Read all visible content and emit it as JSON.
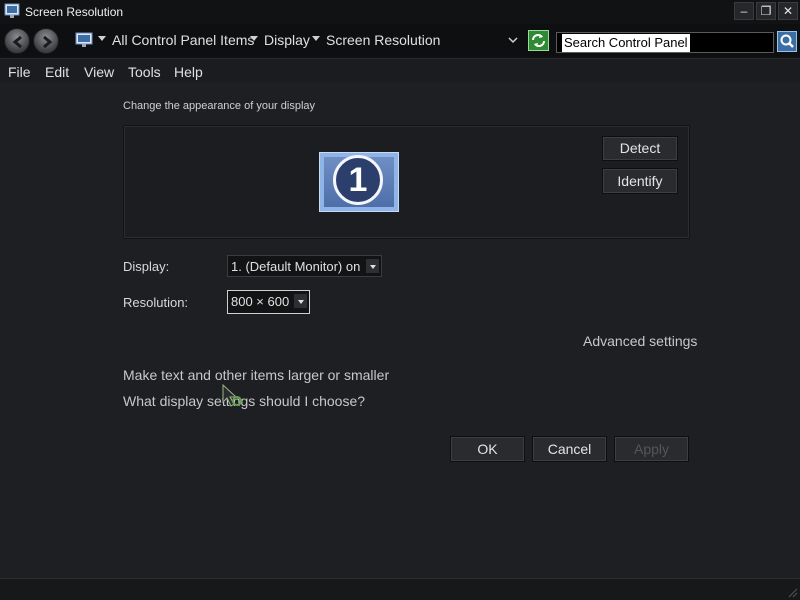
{
  "window": {
    "title": "Screen Resolution",
    "buttons": {
      "minimize": "–",
      "restore": "❐",
      "close": "✕"
    }
  },
  "address": {
    "crumbs": [
      "All Control Panel Items",
      "Display",
      "Screen Resolution"
    ],
    "search_placeholder": "Search Control Panel"
  },
  "menu": {
    "items": [
      {
        "label": "File"
      },
      {
        "label": "Edit"
      },
      {
        "label": "View"
      },
      {
        "label": "Tools"
      },
      {
        "label": "Help"
      }
    ]
  },
  "main": {
    "heading": "Change the appearance of your display",
    "monitor_number": "1",
    "detect_button": "Detect",
    "identify_button": "Identify",
    "display_label": "Display:",
    "display_value": "1. (Default Monitor) on",
    "resolution_label": "Resolution:",
    "resolution_value": "800 × 600",
    "advanced_link": "Advanced settings",
    "text_size_link": "Make text and other items larger or smaller",
    "help_link": "What display settings should I choose?"
  },
  "actions": {
    "ok": "OK",
    "cancel": "Cancel",
    "apply": "Apply"
  },
  "colors": {
    "background": "#1e1f22",
    "titlebar": "#111214",
    "accent_monitor": "#8fb4e8"
  }
}
